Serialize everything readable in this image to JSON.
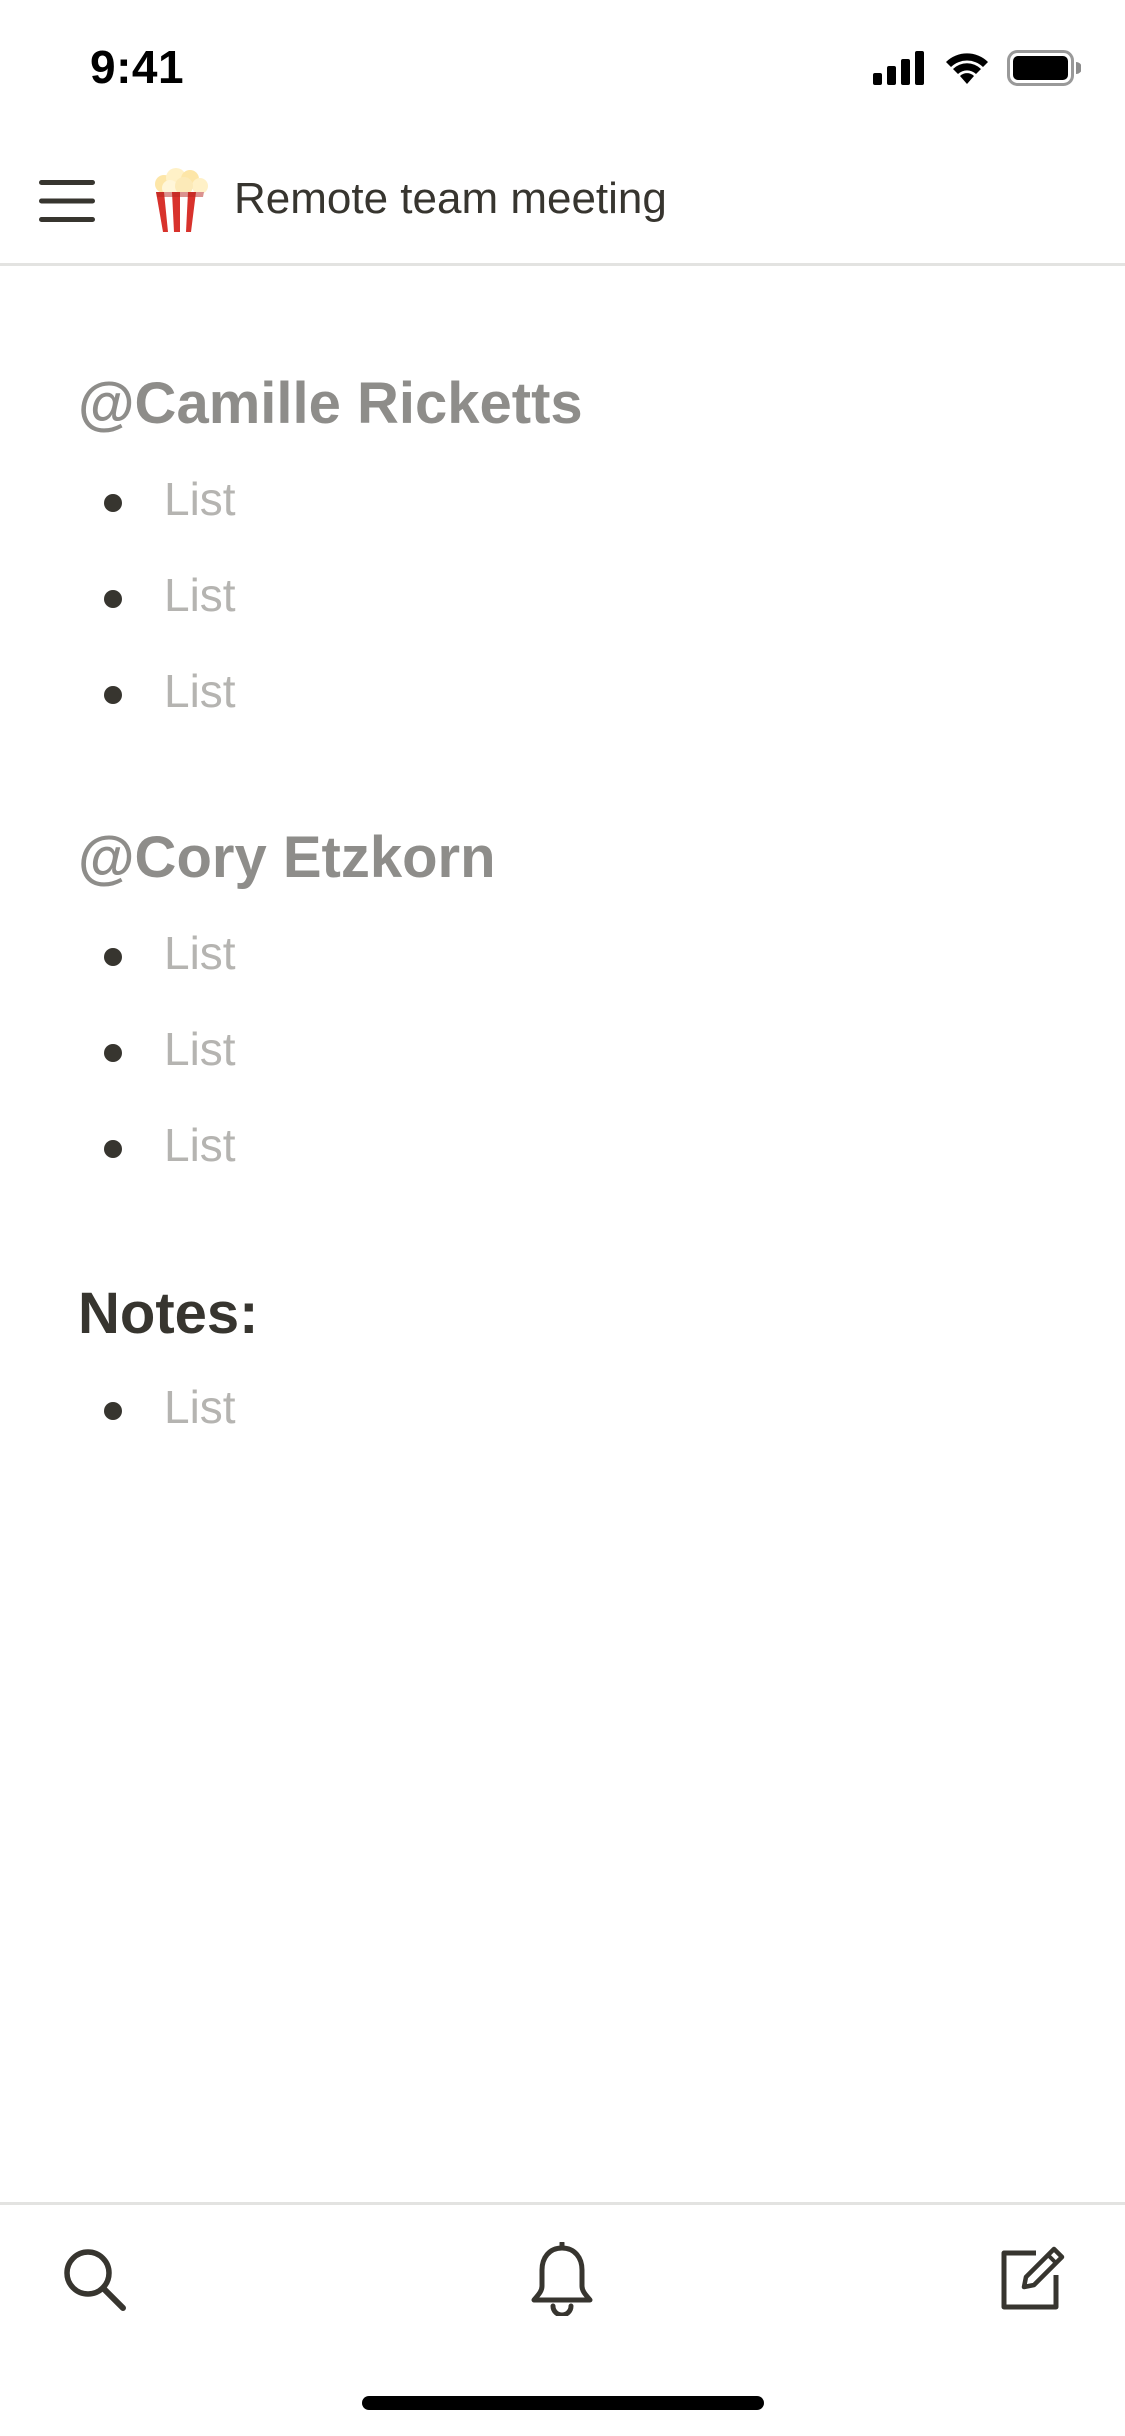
{
  "status_bar": {
    "time": "9:41",
    "icons": [
      "cellular-signal-icon",
      "wifi-icon",
      "battery-icon"
    ]
  },
  "header": {
    "menu_icon": "hamburger-menu-icon",
    "page_icon": "popcorn-emoji",
    "title": "Remote team meeting"
  },
  "sections": [
    {
      "heading": "@Camille Ricketts",
      "items": [
        "List",
        "List",
        "List"
      ]
    },
    {
      "heading": "@Cory Etzkorn",
      "items": [
        "List",
        "List",
        "List"
      ]
    },
    {
      "heading": "Notes:",
      "items": [
        "List"
      ]
    }
  ],
  "bottom_toolbar": {
    "icons": [
      "search-icon",
      "bell-icon",
      "compose-icon"
    ]
  },
  "colors": {
    "text_primary": "#37352f",
    "text_heading_muted": "#8e8d8a",
    "text_placeholder": "#b5b4b1",
    "divider": "#e3e3e1",
    "background": "#ffffff"
  }
}
